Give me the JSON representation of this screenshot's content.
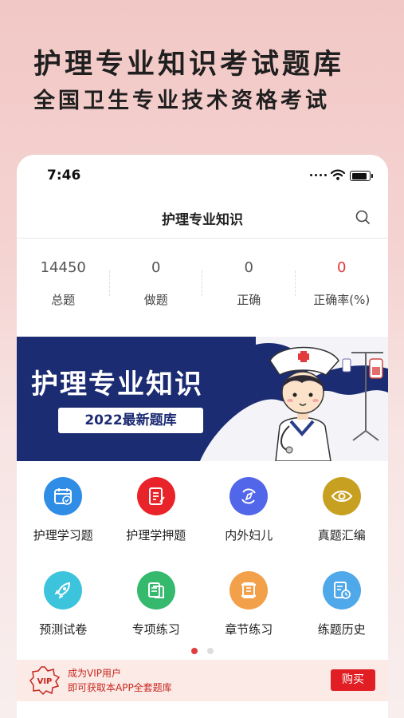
{
  "promo": {
    "title": "护理专业知识考试题库",
    "subtitle": "全国卫生专业技术资格考试"
  },
  "status_bar": {
    "time": "7:46"
  },
  "nav": {
    "title": "护理专业知识",
    "search_icon": "search-icon"
  },
  "stats": [
    {
      "value": "14450",
      "label": "总题"
    },
    {
      "value": "0",
      "label": "做题"
    },
    {
      "value": "0",
      "label": "正确"
    },
    {
      "value": "0",
      "label": "正确率(%)",
      "color": "#e53636"
    }
  ],
  "banner": {
    "title": "护理专业知识",
    "tag": "2022最新题库",
    "background": "#1c2c73"
  },
  "grid": [
    {
      "label": "护理学习题",
      "icon": "calendar-icon",
      "color": "#2f8de6"
    },
    {
      "label": "护理学押题",
      "icon": "notebook-pen-icon",
      "color": "#e8242a"
    },
    {
      "label": "内外妇儿",
      "icon": "compass-icon",
      "color": "#5166e8"
    },
    {
      "label": "真题汇编",
      "icon": "eye-icon",
      "color": "#c8a021"
    },
    {
      "label": "预测试卷",
      "icon": "rocket-icon",
      "color": "#3cc4dc"
    },
    {
      "label": "专项练习",
      "icon": "documents-icon",
      "color": "#35b96c"
    },
    {
      "label": "章节练习",
      "icon": "scroll-icon",
      "color": "#f3a04a"
    },
    {
      "label": "练题历史",
      "icon": "history-icon",
      "color": "#4fa8ea"
    }
  ],
  "pagination": {
    "current": 1,
    "total": 2
  },
  "vip": {
    "badge": "VIP",
    "line1": "成为VIP用户",
    "line2": "即可获取本APP全套题库",
    "button": "购买"
  }
}
